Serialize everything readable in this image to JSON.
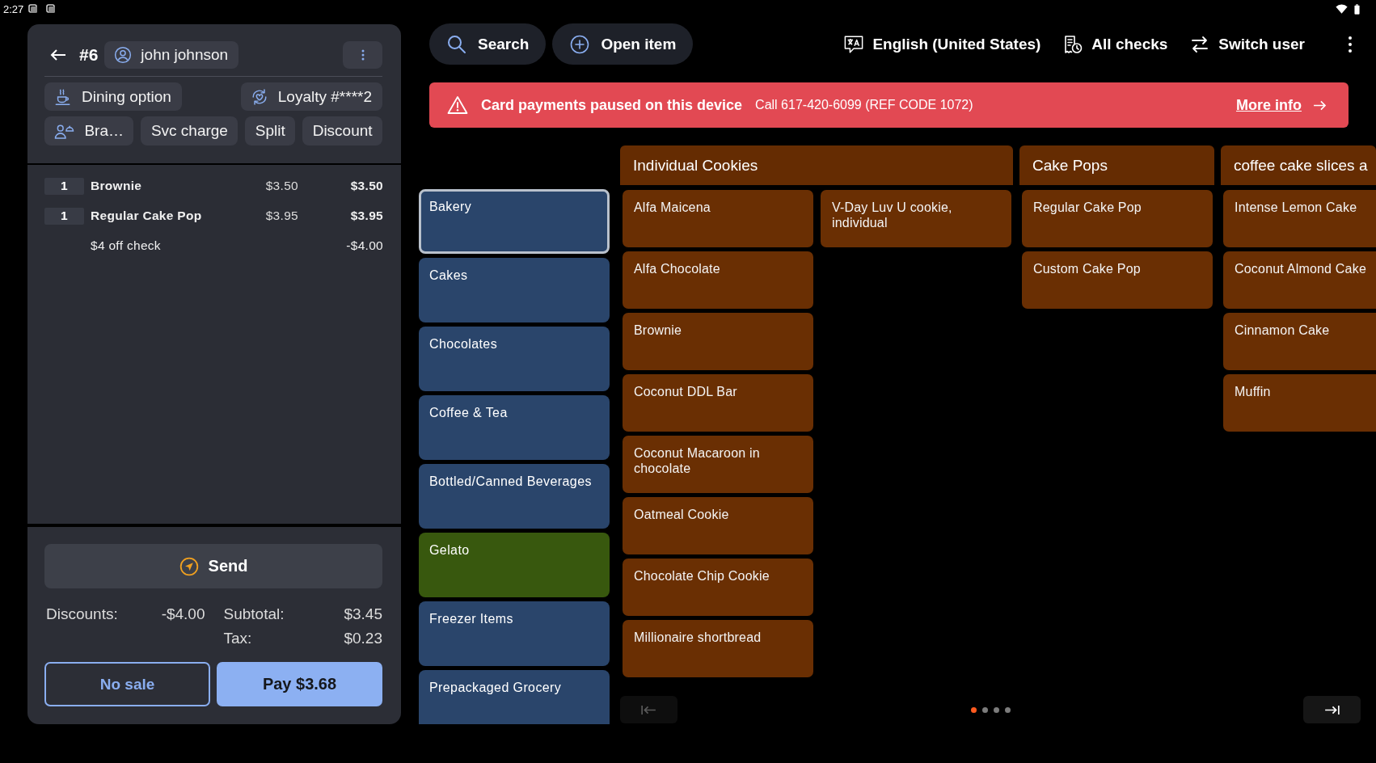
{
  "status_bar": {
    "time": "2:27"
  },
  "order_panel": {
    "check_number": "#6",
    "customer": "john johnson",
    "option_chips": [
      {
        "kind": "dining",
        "label": "Dining option"
      },
      {
        "kind": "loyalty",
        "label": "Loyalty #****2"
      }
    ],
    "action_chips": [
      {
        "kind": "guests",
        "label": "Bra…"
      },
      {
        "kind": "plain",
        "label": "Svc charge"
      },
      {
        "kind": "plain",
        "label": "Split"
      },
      {
        "kind": "plain",
        "label": "Discount"
      }
    ],
    "lines": [
      {
        "kind": "item",
        "quantity": "1",
        "name": "Brownie",
        "price": "$3.50",
        "total": "$3.50"
      },
      {
        "kind": "item",
        "quantity": "1",
        "name": "Regular Cake Pop",
        "price": "$3.95",
        "total": "$3.95"
      },
      {
        "kind": "discount",
        "name": "$4 off check",
        "total": "-$4.00"
      }
    ],
    "send_button": "Send",
    "totals": {
      "discounts": {
        "label": "Discounts:",
        "value": "-$4.00"
      },
      "subtotal": {
        "label": "Subtotal:",
        "value": "$3.45"
      },
      "tax": {
        "label": "Tax:",
        "value": "$0.23"
      }
    },
    "no_sale_button": "No sale",
    "pay_button": "Pay $3.68"
  },
  "toolbar": {
    "search": "Search",
    "open_item": "Open item",
    "language": "English (United States)",
    "all_checks": "All checks",
    "switch_user": "Switch user"
  },
  "alert": {
    "title": "Card payments paused on this device",
    "detail": "Call 617-420-6099 (REF CODE 1072)",
    "link": "More info"
  },
  "categories": [
    {
      "label": "Bakery",
      "color": "#2a456b",
      "selected": true
    },
    {
      "label": "Cakes",
      "color": "#2a456b",
      "selected": false
    },
    {
      "label": "Chocolates",
      "color": "#2a456b",
      "selected": false
    },
    {
      "label": "Coffee & Tea",
      "color": "#2a456b",
      "selected": false
    },
    {
      "label": "Bottled/Canned Beverages",
      "color": "#2a456b",
      "selected": false
    },
    {
      "label": "Gelato",
      "color": "#38580e",
      "selected": false
    },
    {
      "label": "Freezer Items",
      "color": "#2a456b",
      "selected": false
    },
    {
      "label": "Prepackaged Grocery",
      "color": "#2a456b",
      "selected": false
    }
  ],
  "item_groups": [
    {
      "title": "Individual Cookies",
      "items": [
        "Alfa Maicena",
        "Alfa Chocolate",
        "Brownie",
        "Coconut DDL Bar",
        "Coconut Macaroon in chocolate",
        "Oatmeal Cookie",
        "Chocolate Chip Cookie",
        "Millionaire shortbread",
        "V-Day Luv U cookie, individual"
      ]
    },
    {
      "title": "Cake Pops",
      "items": [
        "Regular Cake Pop",
        "Custom Cake Pop"
      ]
    },
    {
      "title": "coffee cake slices a",
      "items": [
        "Intense Lemon Cake",
        "Coconut Almond Cake",
        "Cinnamon Cake",
        "Muffin"
      ]
    }
  ],
  "pagination": {
    "previous": {
      "disabled": true
    },
    "next": {
      "disabled": false
    },
    "pages": [
      {
        "selected": true
      },
      {
        "selected": false
      },
      {
        "selected": false
      },
      {
        "selected": false
      }
    ]
  }
}
